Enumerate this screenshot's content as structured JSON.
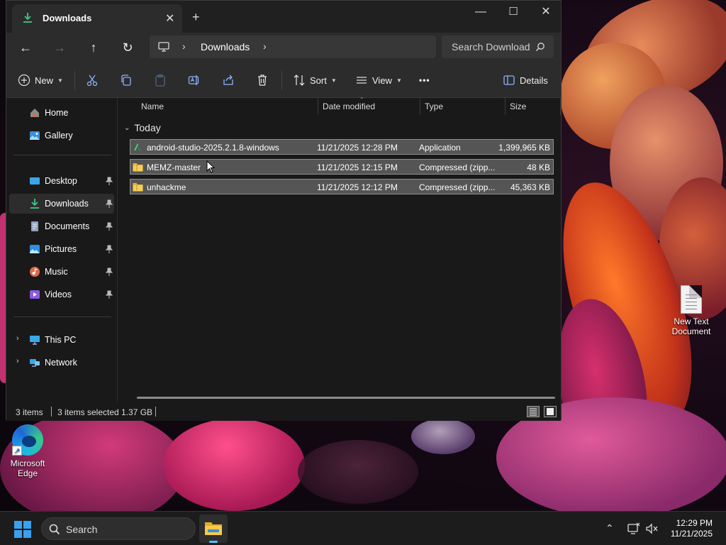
{
  "window": {
    "tab_title": "Downloads",
    "controls": {
      "minimize": "—",
      "maximize": "☐",
      "close": "✕"
    }
  },
  "address": {
    "crumb": "Downloads",
    "search_placeholder": "Search Downloads"
  },
  "toolbar": {
    "new_label": "New",
    "sort_label": "Sort",
    "view_label": "View",
    "more_label": "•••",
    "details_label": "Details"
  },
  "nav": {
    "home": "Home",
    "gallery": "Gallery",
    "desktop": "Desktop",
    "downloads": "Downloads",
    "documents": "Documents",
    "pictures": "Pictures",
    "music": "Music",
    "videos": "Videos",
    "this_pc": "This PC",
    "network": "Network"
  },
  "columns": {
    "name": "Name",
    "date": "Date modified",
    "type": "Type",
    "size": "Size"
  },
  "group_label": "Today",
  "files": [
    {
      "name": "android-studio-2025.2.1.8-windows",
      "date": "11/21/2025 12:28 PM",
      "type": "Application",
      "size": "1,399,965 KB",
      "icon": "android-studio-icon"
    },
    {
      "name": "MEMZ-master",
      "date": "11/21/2025 12:15 PM",
      "type": "Compressed (zipp...",
      "size": "48 KB",
      "icon": "zip-folder-icon"
    },
    {
      "name": "unhackme",
      "date": "11/21/2025 12:12 PM",
      "type": "Compressed (zipp...",
      "size": "45,363 KB",
      "icon": "zip-folder-icon"
    }
  ],
  "status": {
    "count": "3 items",
    "selected": "3 items selected",
    "size": "1.37 GB"
  },
  "desktop": {
    "text_doc_line1": "New Text",
    "text_doc_line2": "Document",
    "edge_line1": "Microsoft",
    "edge_line2": "Edge"
  },
  "taskbar": {
    "search_label": "Search",
    "time": "12:29 PM",
    "date": "11/21/2025"
  },
  "colors": {
    "accent": "#4cc2ff",
    "selection": "#555555",
    "window_bg": "#191919"
  }
}
